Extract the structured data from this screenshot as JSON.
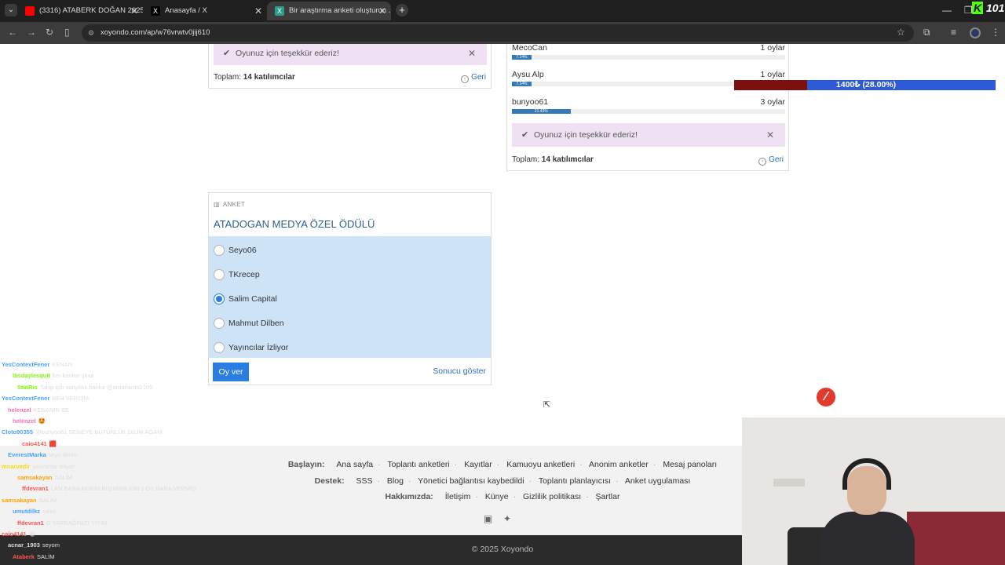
{
  "browser": {
    "tabs": [
      {
        "label": "(3316) ATABERK DOĞAN 2025 ...",
        "icon": "youtube-icon",
        "color": "#ff0000"
      },
      {
        "label": "Anasayfa / X",
        "icon": "x-icon",
        "color": "#000000"
      },
      {
        "label": "Bir araştırma anketi oluşturun ...",
        "icon": "xoyondo-icon",
        "color": "#2a9d8f"
      }
    ],
    "url": "xoyondo.com/ap/w76vrwtv0jij610",
    "overlay_brand": "101"
  },
  "left_results": {
    "thanks": "Oyunuz için teşekkür ederiz!",
    "total_label": "Toplam:",
    "total_value": "14 katılımcılar",
    "back": "Geri"
  },
  "right_results": {
    "rows": [
      {
        "name": "MecoCan",
        "votes": "1 oylar",
        "percent_label": "7.14%",
        "percent": 7.14
      },
      {
        "name": "Aysu Alp",
        "votes": "1 oylar",
        "percent_label": "7.14%",
        "percent": 7.14
      },
      {
        "name": "bunyoo61",
        "votes": "3 oylar",
        "percent_label": "21.43%",
        "percent": 21.43
      }
    ],
    "thanks": "Oyunuz için teşekkür ederiz!",
    "total_label": "Toplam:",
    "total_value": "14 katılımcılar",
    "back": "Geri"
  },
  "donation_overlay": {
    "amount": "1400₺ (28.00%)",
    "progress": 28.0
  },
  "poll": {
    "kicker": "ANKET",
    "title": "ATADOGAN MEDYA ÖZEL ÖDÜLÜ",
    "options": [
      {
        "label": "Seyo06",
        "selected": false
      },
      {
        "label": "TKrecep",
        "selected": false
      },
      {
        "label": "Salim Capital",
        "selected": true
      },
      {
        "label": "Mahmut Dilben",
        "selected": false
      },
      {
        "label": "Yayıncılar İzliyor",
        "selected": false
      }
    ],
    "vote_button": "Oy ver",
    "show_results": "Sonucu göster"
  },
  "footer": {
    "start_label": "Başlayın:",
    "start_links": [
      "Ana sayfa",
      "Toplantı anketleri",
      "Kayıtlar",
      "Kamuoyu anketleri",
      "Anonim anketler",
      "Mesaj panoları"
    ],
    "support_label": "Destek:",
    "support_links": [
      "SSS",
      "Blog",
      "Yönetici bağlantısı kaybedildi",
      "Toplantı planlayıcısı",
      "Anket uygulaması"
    ],
    "about_label": "Hakkımızda:",
    "about_links": [
      "İletişim",
      "Künye",
      "Gizlilik politikası",
      "Şartlar"
    ],
    "copyright": "© 2025 Xoyondo"
  },
  "chat": [
    {
      "user": "YesContextFener",
      "msg": "KENAN",
      "color": "#4aa3ff"
    },
    {
      "user": "lbsdaylesquit",
      "msg": "bm kanton çindi",
      "color": "#7cfc00"
    },
    {
      "user": "StatRis",
      "msg": "Takip için sarşılıklı banka @ardarlardo2109",
      "color": "#7cfc00"
    },
    {
      "user": "YesContextFener",
      "msg": "BEN VERDİM",
      "color": "#4aa3ff"
    },
    {
      "user": "helenzel",
      "msg": "KENANIN BE",
      "color": "#ff6eb4"
    },
    {
      "user": "helenzel",
      "msg": "🤩",
      "color": "#ff6eb4"
    },
    {
      "user": "Cloto90355",
      "msg": "@bunyoo61 SENEYE BÜTÜNLÜK DİLİM AGAM",
      "color": "#4aa3ff"
    },
    {
      "user": "caio4141",
      "msg": "🟥",
      "color": "#ff5555"
    },
    {
      "user": "EverestMarka",
      "msg": "seyo derim",
      "color": "#4aa3ff"
    },
    {
      "user": "mnarvedir",
      "msg": "yayıncılar izliyor",
      "color": "#ffd700"
    },
    {
      "user": "samsakayan",
      "msg": "SALİM",
      "color": "#ffa500"
    },
    {
      "user": "ffdevran1",
      "msg": "LAN BANA BENİM BİŞİMİRA KİM 3 OY BANA VERMİŞ",
      "color": "#ff5555"
    },
    {
      "user": "samsakayan",
      "msg": "SALİM",
      "color": "#ffa500"
    },
    {
      "user": "umutdilkz",
      "msg": "salim",
      "color": "#4aa3ff"
    },
    {
      "user": "ffdevran1",
      "msg": "O YARRAĞINIZI YİYİM",
      "color": "#ff5555"
    },
    {
      "user": "caio4141",
      "msg": "😂",
      "color": "#ff5555"
    },
    {
      "user": "acnar_1903",
      "msg": "seyom",
      "color": "#dddddd"
    },
    {
      "user": "Ataberk",
      "msg": "SALİM",
      "color": "#ff5555"
    }
  ]
}
